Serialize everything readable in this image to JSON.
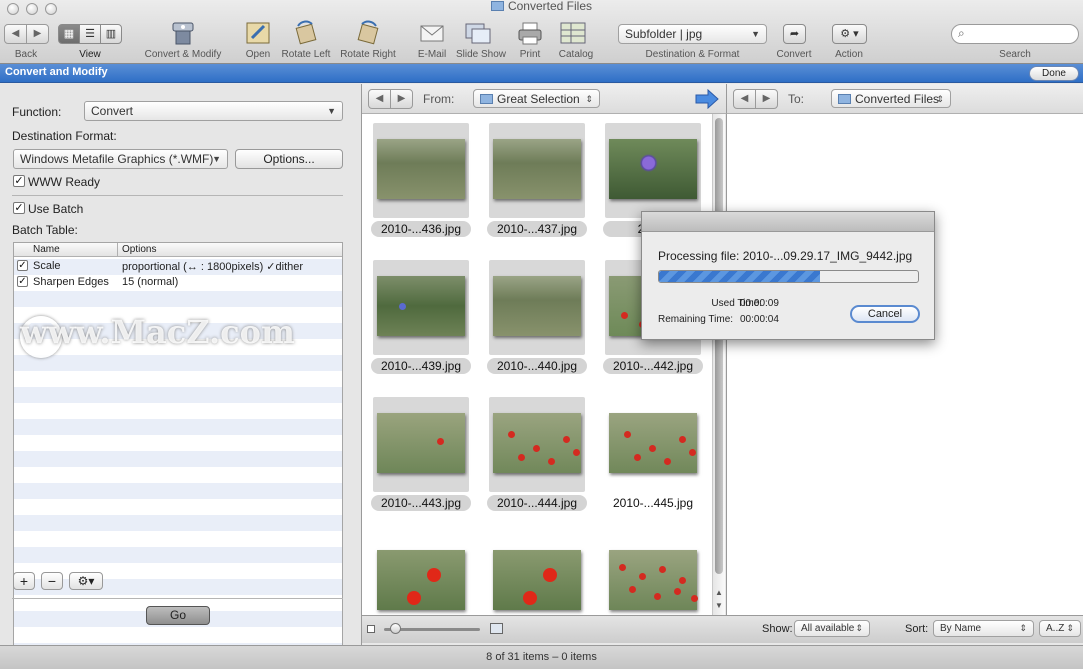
{
  "window": {
    "title": "Converted Files"
  },
  "toolbar": {
    "back_label": "Back",
    "view_label": "View",
    "convert_modify_label": "Convert & Modify",
    "open_label": "Open",
    "rotate_left_label": "Rotate Left",
    "rotate_right_label": "Rotate Right",
    "email_label": "E-Mail",
    "slideshow_label": "Slide Show",
    "print_label": "Print",
    "catalog_label": "Catalog",
    "destination_value": "Subfolder | jpg",
    "destination_label": "Destination & Format",
    "convert_label": "Convert",
    "action_label": "Action",
    "search_label": "Search",
    "search_placeholder": ""
  },
  "panel_header": {
    "title": "Convert and Modify",
    "done_label": "Done"
  },
  "left": {
    "function_label": "Function:",
    "function_value": "Convert",
    "dest_format_label": "Destination Format:",
    "dest_format_value": "Windows Metafile Graphics (*.WMF)",
    "options_button": "Options...",
    "www_ready_label": "WWW Ready",
    "www_ready_checked": true,
    "use_batch_label": "Use Batch",
    "use_batch_checked": true,
    "batch_table_label": "Batch Table:",
    "columns": [
      "Name",
      "Options"
    ],
    "rows": [
      {
        "name": "Scale",
        "options": "proportional (↔ : 1800pixels)  ✓dither",
        "checked": true
      },
      {
        "name": "Sharpen Edges",
        "options": "15 (normal)",
        "checked": true
      }
    ],
    "go_label": "Go"
  },
  "browser": {
    "from_label": "From:",
    "from_value": "Great Selection",
    "to_label": "To:",
    "to_value": "Converted Files",
    "thumbnails": [
      {
        "caption": "2010-...436.jpg",
        "selected": true,
        "scene": "grass"
      },
      {
        "caption": "2010-...437.jpg",
        "selected": true,
        "scene": "grass"
      },
      {
        "caption": "2010-",
        "selected": true,
        "scene": "cornflower"
      },
      {
        "caption": "2010-...439.jpg",
        "selected": true,
        "scene": "cornflower-field"
      },
      {
        "caption": "2010-...440.jpg",
        "selected": true,
        "scene": "grass"
      },
      {
        "caption": "2010-...442.jpg",
        "selected": true,
        "scene": "poppies-sparse"
      },
      {
        "caption": "2010-...443.jpg",
        "selected": true,
        "scene": "poppy-single"
      },
      {
        "caption": "2010-...444.jpg",
        "selected": true,
        "scene": "poppies"
      },
      {
        "caption": "2010-...445.jpg",
        "selected": false,
        "scene": "poppies"
      },
      {
        "caption": "",
        "selected": false,
        "scene": "poppy-close"
      },
      {
        "caption": "",
        "selected": false,
        "scene": "poppy-close"
      },
      {
        "caption": "",
        "selected": false,
        "scene": "poppies-many"
      }
    ]
  },
  "dialog": {
    "processing_text": "Processing file: 2010-...09.29.17_IMG_9442.jpg",
    "progress": 0.62,
    "used_time_label": "Used Time:",
    "used_time_value": "00:00:09",
    "remaining_time_label": "Remaining Time:",
    "remaining_time_value": "00:00:04",
    "cancel_label": "Cancel"
  },
  "bottom": {
    "show_label": "Show:",
    "show_value": "All available",
    "sort_label": "Sort:",
    "sort_value": "By Name",
    "order_value": "A..Z"
  },
  "status": {
    "text": "8 of 31 items – 0 items"
  },
  "watermark": {
    "text": "www.MacZ.com"
  }
}
